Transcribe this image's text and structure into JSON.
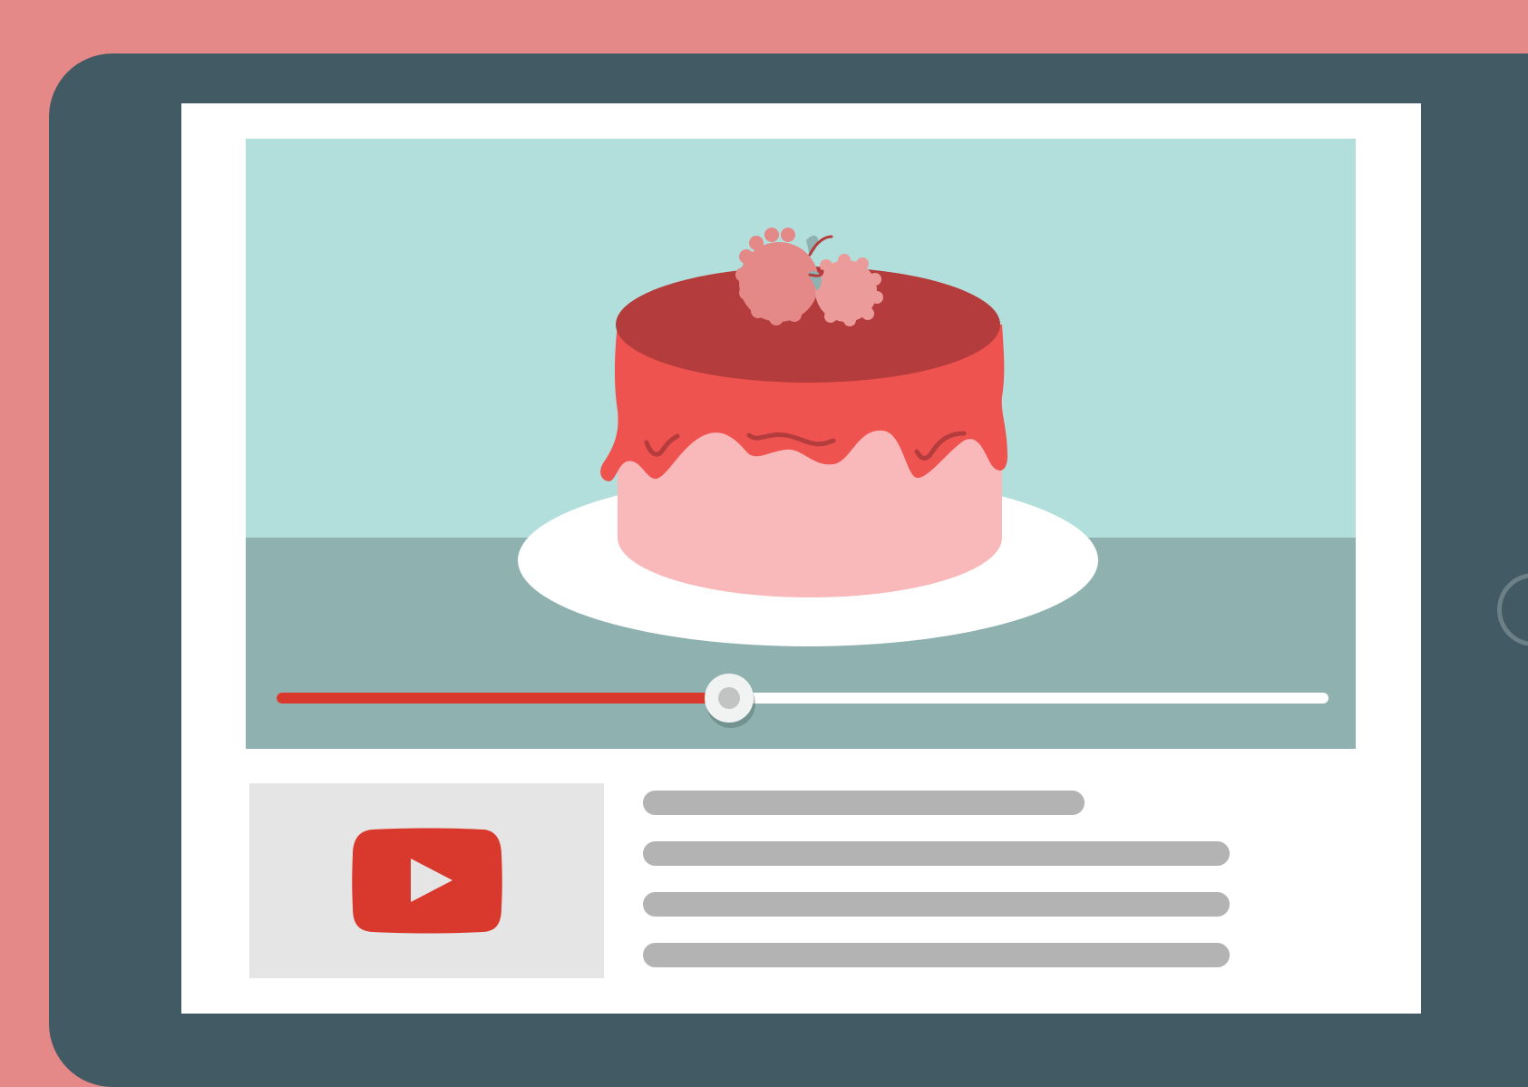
{
  "colors": {
    "background": "#e58888",
    "tablet_frame": "#425a63",
    "accent": "#d9382d"
  },
  "video": {
    "progress": 0.43
  },
  "thumbnail": {
    "icon": "play-logo-icon"
  },
  "description": {
    "placeholder_lines": 4
  }
}
